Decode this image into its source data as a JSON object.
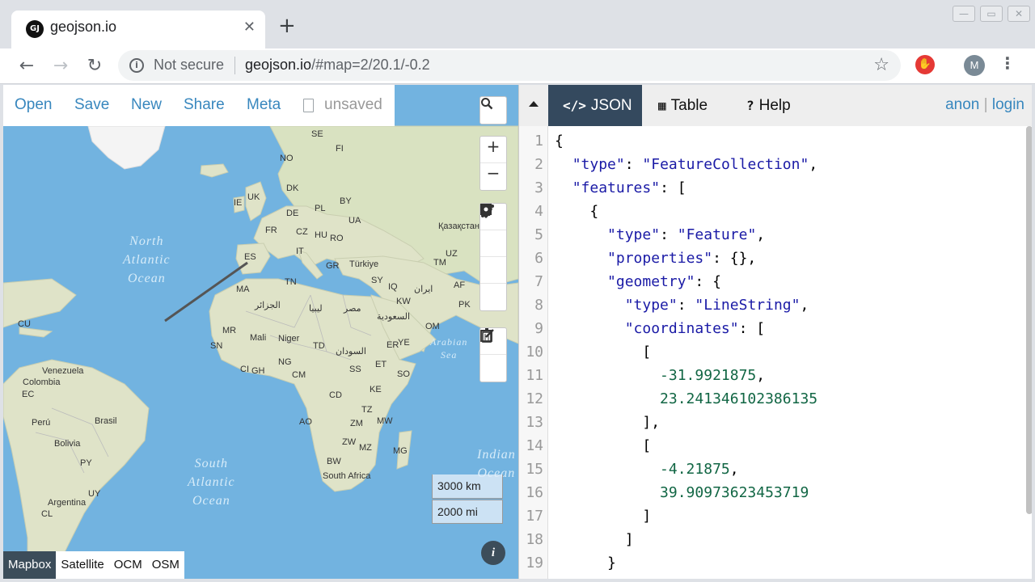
{
  "browser": {
    "tab_title": "geojson.io",
    "tab_favicon": "GJ",
    "security_label": "Not secure",
    "url_host": "geojson.io",
    "url_path": "/#map=2/20.1/-0.2",
    "avatar_initial": "M"
  },
  "map_menu": {
    "open": "Open",
    "save": "Save",
    "new": "New",
    "share": "Share",
    "meta": "Meta",
    "status": "unsaved"
  },
  "map": {
    "oceans": {
      "north_atlantic": [
        "North",
        "Atlantic",
        "Ocean"
      ],
      "south_atlantic": [
        "South",
        "Atlantic",
        "Ocean"
      ],
      "arabian_sea": [
        "Arabian",
        "Sea"
      ],
      "indian": [
        "Indian",
        "Ocean"
      ]
    },
    "labels": [
      "SE",
      "FI",
      "NO",
      "DK",
      "UK",
      "IE",
      "BY",
      "DE",
      "PL",
      "UA",
      "FR",
      "CZ",
      "HU",
      "RO",
      "Қазақстан",
      "IT",
      "ES",
      "GR",
      "Türkiye",
      "UZ",
      "TM",
      "SY",
      "IQ",
      "AF",
      "ایران",
      "KW",
      "PK",
      "TN",
      "MA",
      "الجزائر",
      "ليبيا",
      "مصر",
      "السعودية",
      "OM",
      "MR",
      "Mali",
      "Niger",
      "TD",
      "السودان",
      "ER",
      "YE",
      "SN",
      "GH",
      "NG",
      "CM",
      "ET",
      "SO",
      "CU",
      "Venezuela",
      "Colombia",
      "EC",
      "Perú",
      "Brasil",
      "Bolivia",
      "PY",
      "UY",
      "CL",
      "Argentina",
      "CD",
      "KE",
      "TZ",
      "AO",
      "ZM",
      "MW",
      "ZW",
      "MZ",
      "MG",
      "BW",
      "South Africa",
      "CI",
      "SS"
    ],
    "scale_km": "3000 km",
    "scale_mi": "2000 mi",
    "layers": [
      "Mapbox",
      "Satellite",
      "OCM",
      "OSM"
    ],
    "active_layer": "Mapbox"
  },
  "panel": {
    "tabs": [
      {
        "icon": "code-icon",
        "label": "JSON"
      },
      {
        "icon": "table-icon",
        "label": "Table"
      },
      {
        "icon": "help-icon",
        "label": "Help"
      }
    ],
    "active_tab": "JSON",
    "user": "anon",
    "login": "login"
  },
  "editor": {
    "lines": [
      "{",
      "  \"type\": \"FeatureCollection\",",
      "  \"features\": [",
      "    {",
      "      \"type\": \"Feature\",",
      "      \"properties\": {},",
      "      \"geometry\": {",
      "        \"type\": \"LineString\",",
      "        \"coordinates\": [",
      "          [",
      "            -31.9921875,",
      "            23.241346102386135",
      "          ],",
      "          [",
      "            -4.21875,",
      "            39.90973623453719",
      "          ]",
      "        ]",
      "      }"
    ]
  },
  "colors": {
    "accent": "#3887be",
    "active_tab_bg": "#34495e",
    "water": "#72b3e0",
    "land": "#dfe3c8",
    "drawn_line": "#555555"
  }
}
